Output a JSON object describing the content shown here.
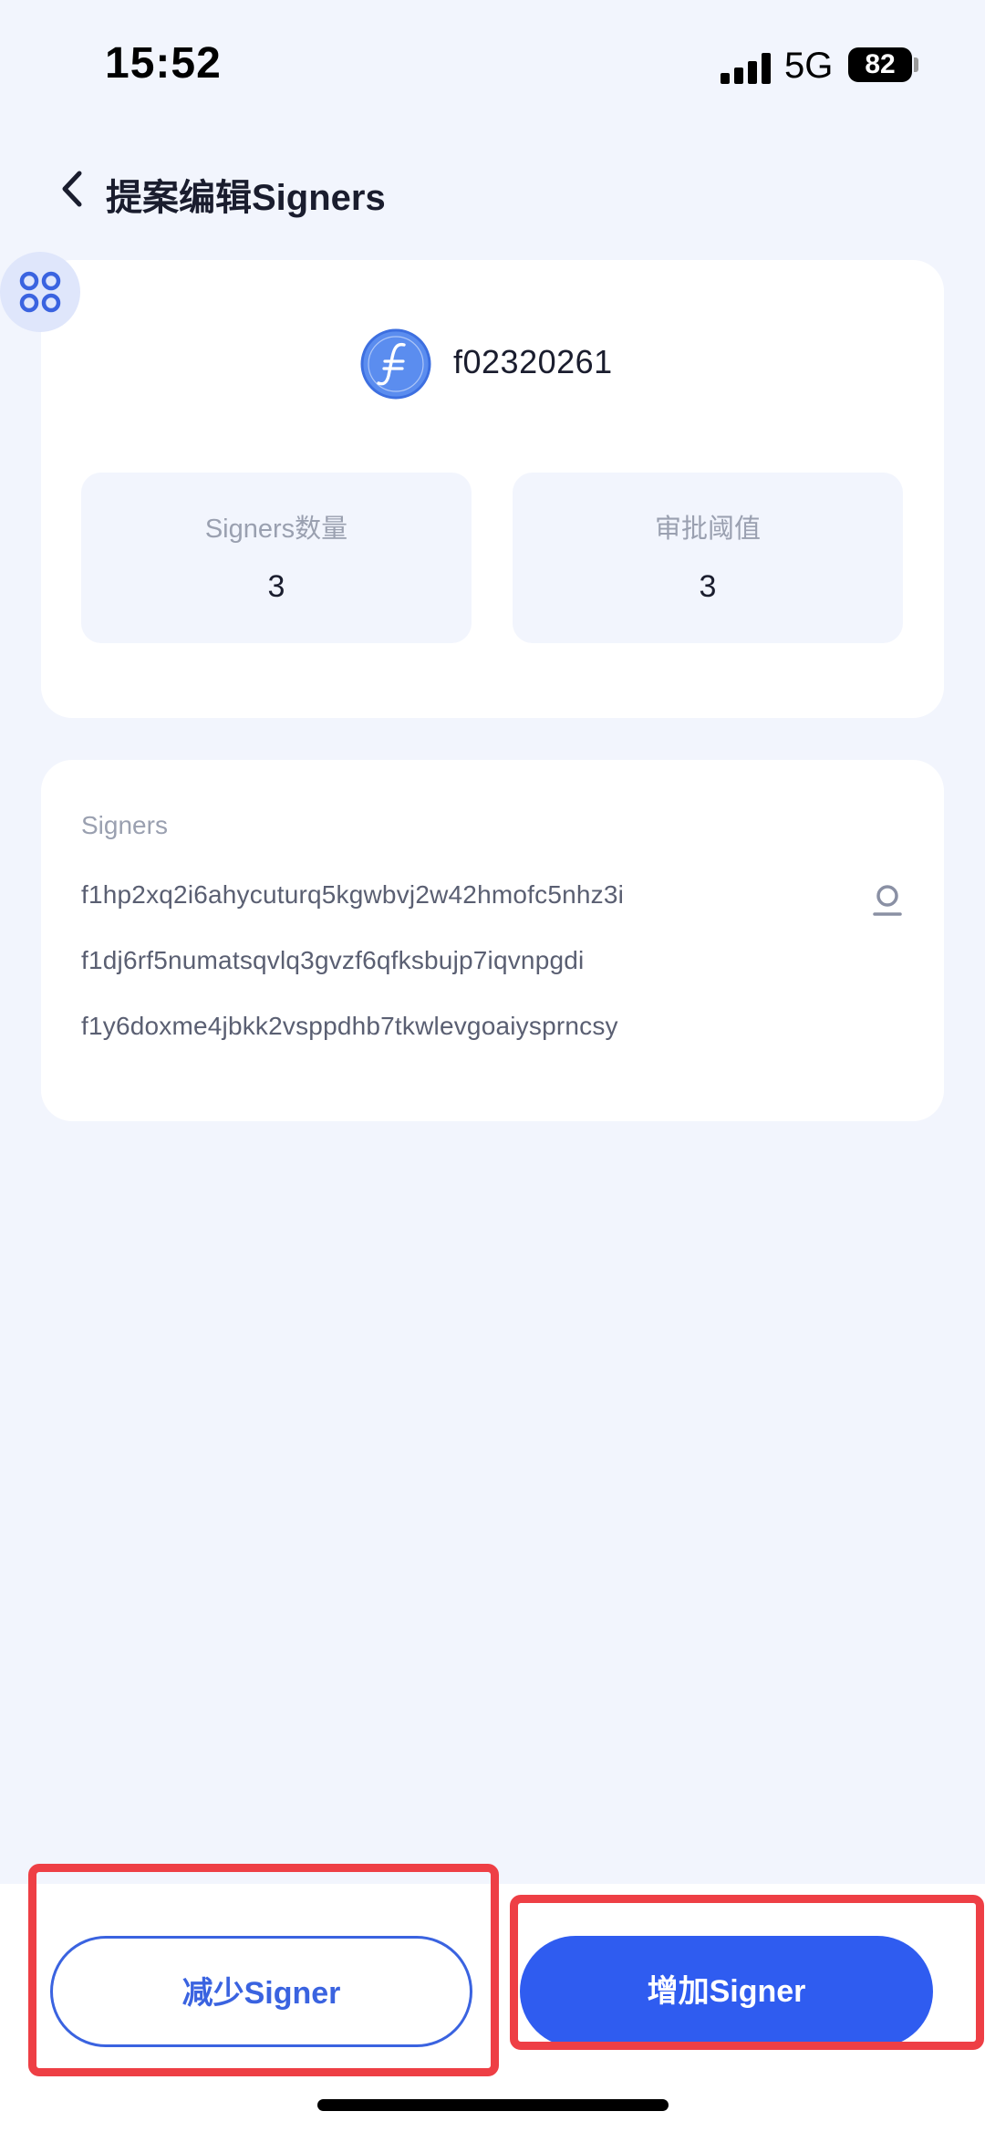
{
  "status_bar": {
    "time": "15:52",
    "network": "5G",
    "battery": "82"
  },
  "header": {
    "title": "提案编辑Signers"
  },
  "wallet": {
    "address": "f02320261"
  },
  "stats": {
    "signers_count_label": "Signers数量",
    "signers_count_value": "3",
    "threshold_label": "审批阈值",
    "threshold_value": "3"
  },
  "signers": {
    "heading": "Signers",
    "list": [
      "f1hp2xq2i6ahycuturq5kgwbvj2w42hmofc5nhz3i",
      "f1dj6rf5numatsqvlq3gvzf6qfksbujp7iqvnpgdi",
      "f1y6doxme4jbkk2vsppdhb7tkwlevgoaiysprncsy"
    ]
  },
  "actions": {
    "decrease_label": "减少Signer",
    "increase_label": "增加Signer"
  },
  "colors": {
    "accent": "#2f5cf0",
    "highlight": "#ee3f45",
    "background": "#f2f5fd"
  }
}
